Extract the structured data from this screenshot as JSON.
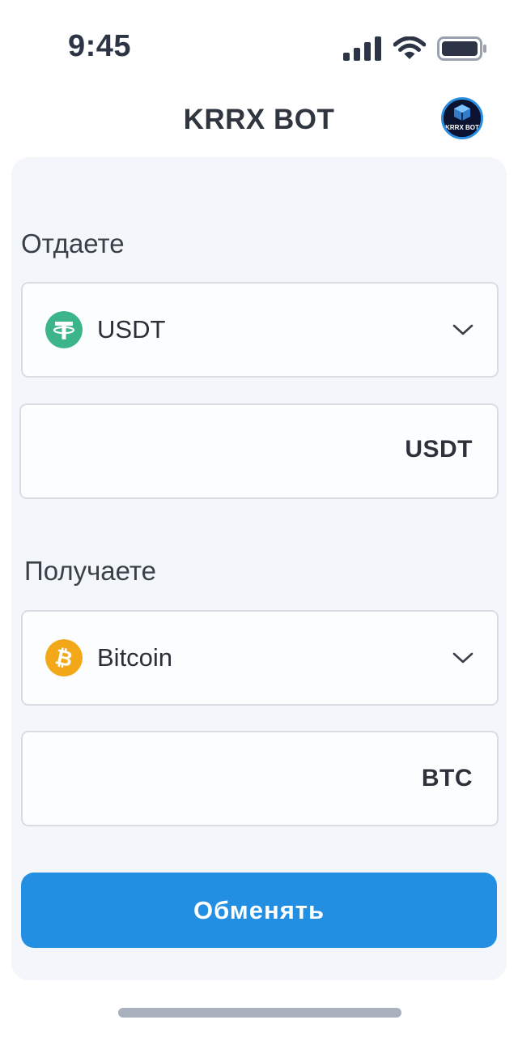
{
  "status_bar": {
    "time": "9:45",
    "icons": [
      "cellular-signal-icon",
      "wifi-icon",
      "battery-icon"
    ]
  },
  "header": {
    "title": "KRRX BOT",
    "avatar_text": "KRRX BOT"
  },
  "give": {
    "label": "Отдаете",
    "currency": "USDT",
    "currency_icon": "tether-icon",
    "amount_value": "",
    "amount_unit": "USDT"
  },
  "receive": {
    "label": "Получаете",
    "currency": "Bitcoin",
    "currency_icon": "bitcoin-icon",
    "amount_value": "",
    "amount_unit": "BTC"
  },
  "exchange_button": "Обменять",
  "colors": {
    "accent": "#238fe3",
    "tether": "#3cb58a",
    "bitcoin": "#f3a81a",
    "card_bg": "#f3f7fb"
  }
}
